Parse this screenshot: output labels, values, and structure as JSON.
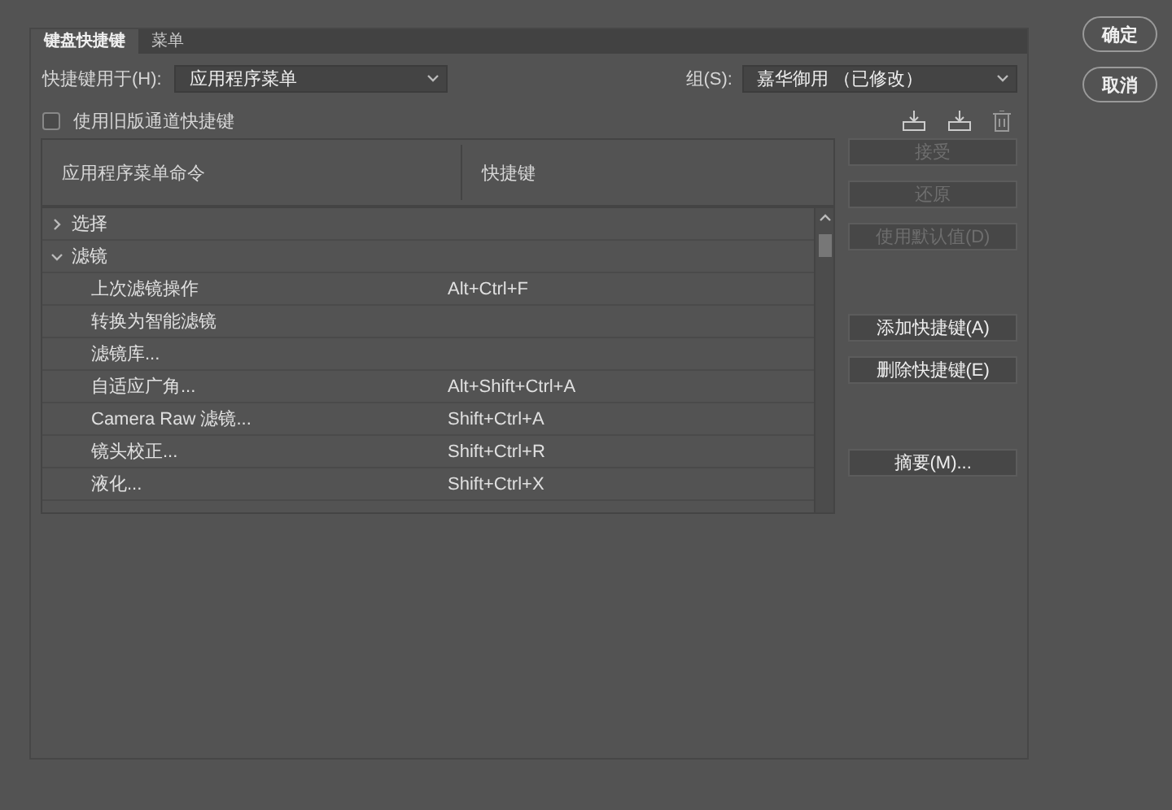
{
  "tabs": [
    {
      "label": "键盘快捷键",
      "selected": true
    },
    {
      "label": "菜单",
      "selected": false
    }
  ],
  "shortcuts_for": {
    "label": "快捷键用于(H):",
    "value": "应用程序菜单"
  },
  "set": {
    "label": "组(S):",
    "value": "嘉华御用 （已修改）"
  },
  "legacy_channel": {
    "label": "使用旧版通道快捷键",
    "checked": false
  },
  "table": {
    "columns": [
      "应用程序菜单命令",
      "快捷键"
    ],
    "rows": [
      {
        "name": "选择",
        "expanded": false,
        "children": []
      },
      {
        "name": "滤镜",
        "expanded": true,
        "children": [
          {
            "name": "上次滤镜操作",
            "shortcut": "Alt+Ctrl+F"
          },
          {
            "name": "转换为智能滤镜"
          },
          {
            "name": "滤镜库..."
          },
          {
            "name": "自适应广角...",
            "shortcut": "Alt+Shift+Ctrl+A"
          },
          {
            "name": "Camera Raw 滤镜...",
            "shortcut": "Shift+Ctrl+A"
          },
          {
            "name": "镜头校正...",
            "shortcut": "Shift+Ctrl+R"
          },
          {
            "name": "液化...",
            "shortcut": "Shift+Ctrl+X"
          }
        ]
      }
    ]
  },
  "side_buttons": [
    {
      "label": "接受",
      "disabled": true
    },
    {
      "label": "还原",
      "disabled": true
    },
    {
      "label": "使用默认值(D)",
      "disabled": true
    },
    {
      "label": "添加快捷键(A)",
      "disabled": false
    },
    {
      "label": "删除快捷键(E)",
      "disabled": false
    },
    {
      "label": "摘要(M)...",
      "disabled": false
    }
  ],
  "dialog_buttons": [
    "确定",
    "取消"
  ]
}
